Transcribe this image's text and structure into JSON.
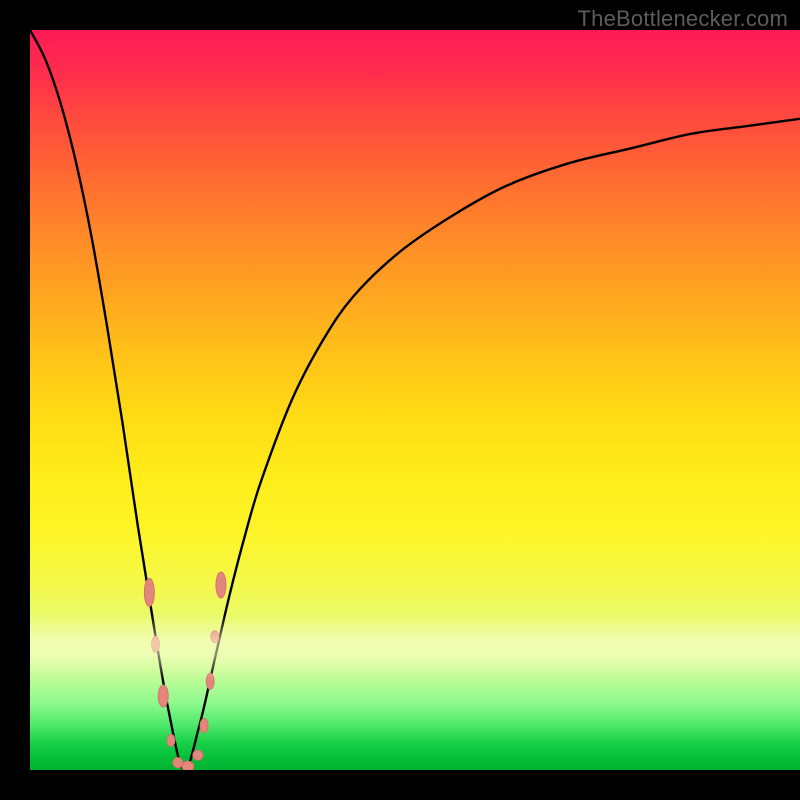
{
  "watermark_text": "TheBottlenecker.com",
  "colors": {
    "frame": "#000000",
    "curve": "#000000",
    "bead_fill": "#e3867b",
    "bead_stroke": "#d6746b",
    "gradient_top": "#ff1a56",
    "gradient_mid": "#ffe016",
    "gradient_bottom": "#00b231"
  },
  "chart_data": {
    "type": "line",
    "title": "",
    "xlabel": "",
    "ylabel": "",
    "xlim": [
      0,
      100
    ],
    "ylim": [
      0,
      100
    ],
    "notes": "Absolute-difference / bottleneck curve. y≈0 (optimal, green) at x≈20; rises sharply to ~100 at x→0 and asymptotically toward ~88 as x→100. Bead markers cluster near the minimum.",
    "series": [
      {
        "name": "bottleneck-curve",
        "x": [
          0,
          2,
          4,
          6,
          8,
          10,
          12,
          14,
          16,
          18,
          20,
          22,
          24,
          26,
          28,
          30,
          34,
          38,
          42,
          48,
          55,
          62,
          70,
          78,
          86,
          93,
          100
        ],
        "y": [
          100,
          96,
          90,
          82,
          72,
          60,
          47,
          33,
          20,
          8,
          0,
          6,
          15,
          24,
          32,
          39,
          50,
          58,
          64,
          70,
          75,
          79,
          82,
          84,
          86,
          87,
          88
        ]
      }
    ],
    "markers": [
      {
        "x": 15.5,
        "y": 24,
        "rx": 5,
        "ry": 14
      },
      {
        "x": 16.3,
        "y": 17,
        "rx": 4,
        "ry": 8
      },
      {
        "x": 17.3,
        "y": 10,
        "rx": 5,
        "ry": 11
      },
      {
        "x": 18.3,
        "y": 4,
        "rx": 4,
        "ry": 6
      },
      {
        "x": 19.2,
        "y": 1,
        "rx": 5,
        "ry": 5
      },
      {
        "x": 20.5,
        "y": 0.5,
        "rx": 6,
        "ry": 5
      },
      {
        "x": 21.8,
        "y": 2,
        "rx": 5,
        "ry": 5
      },
      {
        "x": 22.6,
        "y": 6,
        "rx": 4,
        "ry": 7
      },
      {
        "x": 23.4,
        "y": 12,
        "rx": 4,
        "ry": 8
      },
      {
        "x": 24.0,
        "y": 18,
        "rx": 4,
        "ry": 6
      },
      {
        "x": 24.8,
        "y": 25,
        "rx": 5,
        "ry": 13
      }
    ]
  }
}
